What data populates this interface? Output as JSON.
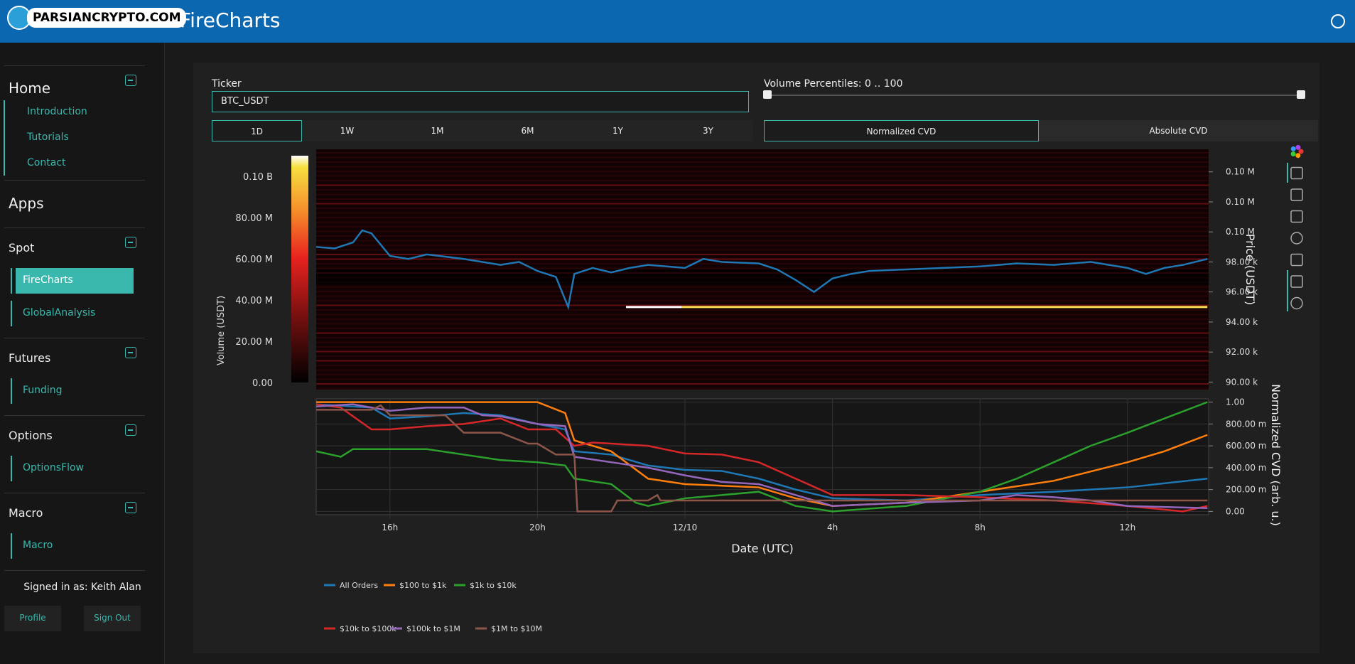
{
  "header": {
    "title": "FireCharts",
    "logo_text": "PARSIANCRYPTO.COM",
    "color": "#0b67b0"
  },
  "sidebar": {
    "home": {
      "title": "Home",
      "items": [
        "Introduction",
        "Tutorials",
        "Contact"
      ]
    },
    "apps_title": "Apps",
    "spot": {
      "title": "Spot",
      "items": [
        "FireCharts",
        "GlobalAnalysis"
      ]
    },
    "futures": {
      "title": "Futures",
      "items": [
        "Funding"
      ]
    },
    "options": {
      "title": "Options",
      "items": [
        "OptionsFlow"
      ]
    },
    "macro": {
      "title": "Macro",
      "items": [
        "Macro"
      ]
    },
    "signed_in": "Signed in as: Keith Alan",
    "profile": "Profile",
    "signout": "Sign Out",
    "accent": "#3ab8ad"
  },
  "controls": {
    "ticker_label": "Ticker",
    "ticker_value": "BTC_USDT",
    "periods": [
      "1D",
      "1W",
      "1M",
      "6M",
      "1Y",
      "3Y"
    ],
    "active_period": "1D",
    "volume_label": "Volume Percentiles: 0 .. 100",
    "volume_range": [
      0,
      100
    ],
    "cvd_modes": [
      "Normalized CVD",
      "Absolute CVD"
    ],
    "active_cvd": "Normalized CVD"
  },
  "chart_data": [
    {
      "type": "heatmap",
      "ylabel": "Price (USDT)",
      "colorbar_label": "Volume (USDT)",
      "colorbar_ticks": [
        "0.00",
        "20.00 M",
        "40.00 M",
        "60.00 M",
        "80.00 M",
        "0.10 B"
      ],
      "colorbar_range": [
        0,
        110000000
      ],
      "y_ticks": [
        "90.00 k",
        "92.00 k",
        "94.00 k",
        "96.00 k",
        "98.00 k",
        "0.10 M",
        "0.10 M",
        "0.10 M"
      ],
      "y_tick_values": [
        90000,
        92000,
        94000,
        96000,
        98000,
        100000,
        102000,
        104000
      ],
      "ylim": [
        89500,
        105500
      ],
      "price_series": {
        "color": "#1f77b4",
        "points": [
          [
            "12/09 14:00",
            99000
          ],
          [
            "12/09 14:30",
            98900
          ],
          [
            "12/09 15:00",
            99300
          ],
          [
            "12/09 15:15",
            100100
          ],
          [
            "12/09 15:30",
            99900
          ],
          [
            "12/09 16:00",
            98400
          ],
          [
            "12/09 16:30",
            98200
          ],
          [
            "12/09 17:00",
            98500
          ],
          [
            "12/09 18:00",
            98200
          ],
          [
            "12/09 19:00",
            97800
          ],
          [
            "12/09 19:30",
            98000
          ],
          [
            "12/09 20:00",
            97400
          ],
          [
            "12/09 20:30",
            97000
          ],
          [
            "12/09 20:50",
            95000
          ],
          [
            "12/09 21:00",
            97200
          ],
          [
            "12/09 21:30",
            97600
          ],
          [
            "12/09 22:00",
            97300
          ],
          [
            "12/09 22:30",
            97600
          ],
          [
            "12/09 23:00",
            97800
          ],
          [
            "12/10 00:00",
            97600
          ],
          [
            "12/10 00:30",
            98200
          ],
          [
            "12/10 01:00",
            98000
          ],
          [
            "12/10 02:00",
            97900
          ],
          [
            "12/10 02:30",
            97500
          ],
          [
            "12/10 03:00",
            96800
          ],
          [
            "12/10 03:30",
            96000
          ],
          [
            "12/10 04:00",
            96900
          ],
          [
            "12/10 04:30",
            97200
          ],
          [
            "12/10 05:00",
            97400
          ],
          [
            "12/10 06:00",
            97500
          ],
          [
            "12/10 07:00",
            97600
          ],
          [
            "12/10 08:00",
            97700
          ],
          [
            "12/10 09:00",
            97900
          ],
          [
            "12/10 10:00",
            97800
          ],
          [
            "12/10 11:00",
            98000
          ],
          [
            "12/10 12:00",
            97600
          ],
          [
            "12/10 12:30",
            97200
          ],
          [
            "12/10 13:00",
            97600
          ],
          [
            "12/10 13:30",
            97800
          ],
          [
            "12/10 14:10",
            98200
          ]
        ]
      },
      "level_line": {
        "price": 95000,
        "start": "12/09 22:24",
        "white_until": "12/09 23:55",
        "end": "12/10 14:10",
        "color": "#f5e050"
      }
    },
    {
      "type": "line",
      "xlabel": "Date (UTC)",
      "ylabel": "Normalized CVD (arb. u.)",
      "x_ticks": [
        "16h",
        "20h",
        "12/10",
        "4h",
        "8h",
        "12h"
      ],
      "x_tick_times": [
        "12/09 16:00",
        "12/09 20:00",
        "12/10 00:00",
        "12/10 04:00",
        "12/10 08:00",
        "12/10 12:00"
      ],
      "xlim": [
        "12/09 14:00",
        "12/10 14:12"
      ],
      "y_ticks": [
        "0.00",
        "200.00 m",
        "400.00 m",
        "600.00 m",
        "800.00 m",
        "1.00"
      ],
      "ylim": [
        -0.03,
        1.03
      ],
      "legend_position": "bottom",
      "series": [
        {
          "name": "All Orders",
          "color": "#1f77b4",
          "points": [
            [
              "12/09 14:00",
              0.98
            ],
            [
              "12/09 15:30",
              0.95
            ],
            [
              "12/09 16:00",
              0.85
            ],
            [
              "12/09 17:00",
              0.87
            ],
            [
              "12/09 18:00",
              0.9
            ],
            [
              "12/09 19:00",
              0.88
            ],
            [
              "12/09 20:00",
              0.8
            ],
            [
              "12/09 20:45",
              0.75
            ],
            [
              "12/09 21:00",
              0.55
            ],
            [
              "12/09 22:00",
              0.52
            ],
            [
              "12/09 23:00",
              0.42
            ],
            [
              "12/10 00:00",
              0.38
            ],
            [
              "12/10 01:00",
              0.37
            ],
            [
              "12/10 02:00",
              0.3
            ],
            [
              "12/10 03:00",
              0.2
            ],
            [
              "12/10 04:00",
              0.12
            ],
            [
              "12/10 06:00",
              0.1
            ],
            [
              "12/10 08:00",
              0.15
            ],
            [
              "12/10 10:00",
              0.18
            ],
            [
              "12/10 12:00",
              0.22
            ],
            [
              "12/10 14:10",
              0.3
            ]
          ]
        },
        {
          "name": "$100 to $1k",
          "color": "#ff7f0e",
          "points": [
            [
              "12/09 14:00",
              1.0
            ],
            [
              "12/09 20:00",
              1.0
            ],
            [
              "12/09 20:45",
              0.9
            ],
            [
              "12/09 21:00",
              0.65
            ],
            [
              "12/09 22:00",
              0.55
            ],
            [
              "12/09 23:00",
              0.3
            ],
            [
              "12/10 00:00",
              0.25
            ],
            [
              "12/10 02:00",
              0.22
            ],
            [
              "12/10 03:00",
              0.12
            ],
            [
              "12/10 04:00",
              0.05
            ],
            [
              "12/10 06:00",
              0.08
            ],
            [
              "12/10 08:00",
              0.18
            ],
            [
              "12/10 10:00",
              0.28
            ],
            [
              "12/10 12:00",
              0.45
            ],
            [
              "12/10 13:00",
              0.55
            ],
            [
              "12/10 14:10",
              0.7
            ]
          ]
        },
        {
          "name": "$1k to $10k",
          "color": "#2ca02c",
          "points": [
            [
              "12/09 14:00",
              0.55
            ],
            [
              "12/09 14:40",
              0.5
            ],
            [
              "12/09 15:00",
              0.57
            ],
            [
              "12/09 17:00",
              0.57
            ],
            [
              "12/09 18:00",
              0.52
            ],
            [
              "12/09 19:00",
              0.47
            ],
            [
              "12/09 20:00",
              0.45
            ],
            [
              "12/09 20:45",
              0.42
            ],
            [
              "12/09 21:00",
              0.3
            ],
            [
              "12/09 22:00",
              0.25
            ],
            [
              "12/09 22:40",
              0.08
            ],
            [
              "12/09 23:00",
              0.05
            ],
            [
              "12/10 00:00",
              0.12
            ],
            [
              "12/10 01:00",
              0.15
            ],
            [
              "12/10 02:00",
              0.18
            ],
            [
              "12/10 03:00",
              0.05
            ],
            [
              "12/10 04:00",
              0.0
            ],
            [
              "12/10 06:00",
              0.05
            ],
            [
              "12/10 08:00",
              0.18
            ],
            [
              "12/10 09:00",
              0.3
            ],
            [
              "12/10 10:00",
              0.45
            ],
            [
              "12/10 11:00",
              0.6
            ],
            [
              "12/10 12:00",
              0.72
            ],
            [
              "12/10 13:00",
              0.85
            ],
            [
              "12/10 14:10",
              1.0
            ]
          ]
        },
        {
          "name": "$10k to $100k",
          "color": "#d62728",
          "points": [
            [
              "12/09 14:00",
              0.98
            ],
            [
              "12/09 14:40",
              0.95
            ],
            [
              "12/09 15:30",
              0.75
            ],
            [
              "12/09 16:00",
              0.75
            ],
            [
              "12/09 17:00",
              0.78
            ],
            [
              "12/09 18:00",
              0.8
            ],
            [
              "12/09 19:00",
              0.85
            ],
            [
              "12/09 19:45",
              0.75
            ],
            [
              "12/09 20:30",
              0.75
            ],
            [
              "12/09 21:00",
              0.6
            ],
            [
              "12/09 21:30",
              0.63
            ],
            [
              "12/09 22:00",
              0.62
            ],
            [
              "12/09 23:00",
              0.6
            ],
            [
              "12/10 00:00",
              0.53
            ],
            [
              "12/10 01:00",
              0.52
            ],
            [
              "12/10 02:00",
              0.45
            ],
            [
              "12/10 03:00",
              0.3
            ],
            [
              "12/10 04:00",
              0.15
            ],
            [
              "12/10 06:00",
              0.15
            ],
            [
              "12/10 08:00",
              0.13
            ],
            [
              "12/10 10:00",
              0.1
            ],
            [
              "12/10 12:00",
              0.05
            ],
            [
              "12/10 13:30",
              0.0
            ],
            [
              "12/10 14:10",
              0.05
            ]
          ]
        },
        {
          "name": "$100k to $1M",
          "color": "#9467bd",
          "points": [
            [
              "12/09 14:00",
              0.96
            ],
            [
              "12/09 15:00",
              0.98
            ],
            [
              "12/09 16:00",
              0.92
            ],
            [
              "12/09 17:00",
              0.95
            ],
            [
              "12/09 18:00",
              0.95
            ],
            [
              "12/09 18:30",
              0.88
            ],
            [
              "12/09 19:00",
              0.87
            ],
            [
              "12/09 20:00",
              0.8
            ],
            [
              "12/09 20:45",
              0.78
            ],
            [
              "12/09 21:00",
              0.5
            ],
            [
              "12/09 22:00",
              0.45
            ],
            [
              "12/09 23:00",
              0.4
            ],
            [
              "12/10 00:00",
              0.33
            ],
            [
              "12/10 01:00",
              0.27
            ],
            [
              "12/10 02:00",
              0.25
            ],
            [
              "12/10 03:00",
              0.15
            ],
            [
              "12/10 04:00",
              0.05
            ],
            [
              "12/10 06:00",
              0.08
            ],
            [
              "12/10 08:00",
              0.1
            ],
            [
              "12/10 09:00",
              0.15
            ],
            [
              "12/10 10:00",
              0.13
            ],
            [
              "12/10 11:00",
              0.1
            ],
            [
              "12/10 12:00",
              0.05
            ],
            [
              "12/10 14:10",
              0.03
            ]
          ]
        },
        {
          "name": "$1M to $10M",
          "color": "#8c564b",
          "points": [
            [
              "12/09 14:00",
              0.93
            ],
            [
              "12/09 15:30",
              0.93
            ],
            [
              "12/09 15:45",
              0.97
            ],
            [
              "12/09 16:00",
              0.88
            ],
            [
              "12/09 17:30",
              0.88
            ],
            [
              "12/09 18:00",
              0.72
            ],
            [
              "12/09 19:00",
              0.72
            ],
            [
              "12/09 19:45",
              0.62
            ],
            [
              "12/09 20:00",
              0.62
            ],
            [
              "12/09 20:30",
              0.52
            ],
            [
              "12/09 21:00",
              0.52
            ],
            [
              "12/09 21:05",
              0.0
            ],
            [
              "12/09 22:00",
              0.0
            ],
            [
              "12/09 22:10",
              0.1
            ],
            [
              "12/09 23:00",
              0.1
            ],
            [
              "12/09 23:15",
              0.15
            ],
            [
              "12/09 23:20",
              0.1
            ],
            [
              "12/10 14:10",
              0.1
            ]
          ]
        }
      ]
    }
  ],
  "toolbar": {
    "icons": [
      "plotly-logo-icon",
      "pan-icon",
      "box-zoom-icon",
      "wheel-zoom-icon",
      "reset-icon",
      "save-icon",
      "hover-icon",
      "crosshair-icon"
    ]
  }
}
